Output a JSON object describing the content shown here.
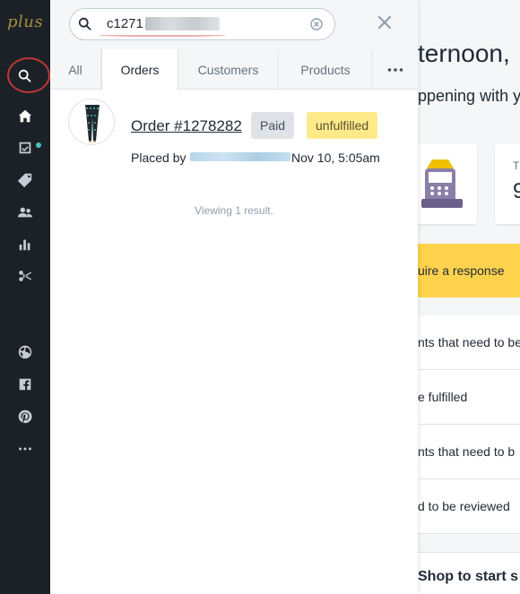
{
  "brand": {
    "logo_text": "plus"
  },
  "leftnav": {
    "items": [
      {
        "name": "search",
        "icon": "search-icon",
        "active": true
      },
      {
        "name": "home",
        "icon": "home-icon"
      },
      {
        "name": "orders",
        "icon": "orders-icon",
        "has_notification": true
      },
      {
        "name": "products",
        "icon": "tag-icon"
      },
      {
        "name": "customers",
        "icon": "people-icon"
      },
      {
        "name": "analytics",
        "icon": "bar-chart-icon"
      },
      {
        "name": "discounts",
        "icon": "scissors-icon"
      },
      {
        "name": "online-store",
        "icon": "globe-icon"
      },
      {
        "name": "facebook",
        "icon": "facebook-icon"
      },
      {
        "name": "pinterest",
        "icon": "pinterest-icon"
      },
      {
        "name": "more",
        "icon": "more-dots-icon"
      }
    ]
  },
  "search": {
    "query_visible": "c1271",
    "tabs": [
      {
        "label": "All",
        "active": false
      },
      {
        "label": "Orders",
        "active": true
      },
      {
        "label": "Customers",
        "active": false
      },
      {
        "label": "Products",
        "active": false
      }
    ]
  },
  "results": [
    {
      "order_label": "Order #1278282",
      "payment_status": "Paid",
      "fulfillment_status": "unfulfilled",
      "placed_by_prefix": "Placed by",
      "placed_date": "Nov 10, 5:05am"
    }
  ],
  "results_summary": "Viewing 1 result.",
  "dashboard_bg": {
    "greeting": "ternoon,",
    "subtitle": "ppening with y",
    "card_label": "T",
    "card_value": "9",
    "banner": "uire a response",
    "rows": [
      "nts that need to be",
      "e fulfilled",
      "nts that need to b",
      "d to be reviewed"
    ],
    "bottom_text": "Shop to start s"
  },
  "colors": {
    "nav_bg": "#1c2127",
    "accent_notification": "#47c1bf",
    "unfulfilled_badge": "#ffea8a",
    "paid_badge": "#dfe3e8",
    "banner": "#ffd24d"
  }
}
